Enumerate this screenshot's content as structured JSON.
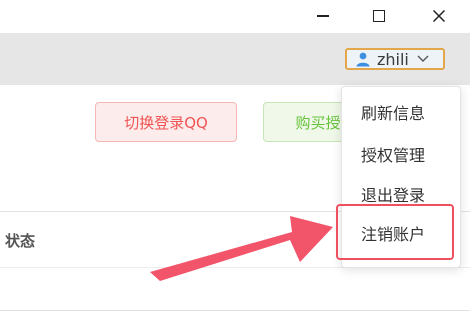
{
  "window": {
    "minimize_icon": "minimize-icon",
    "maximize_icon": "maximize-icon",
    "close_icon": "close-icon"
  },
  "user": {
    "name": "zhili",
    "icon": "user-icon",
    "caret_icon": "chevron-down-icon",
    "border_color": "#e3a64b"
  },
  "actions": {
    "switch_login": "切换登录QQ",
    "buy": "购买授"
  },
  "table": {
    "columns": [
      "状态"
    ]
  },
  "menu": {
    "items": [
      "刷新信息",
      "授权管理",
      "退出登录",
      "注销账户"
    ],
    "highlighted": "注销账户",
    "highlight_color": "#f0505e"
  },
  "annotation": {
    "arrow_color": "#f2546a"
  }
}
